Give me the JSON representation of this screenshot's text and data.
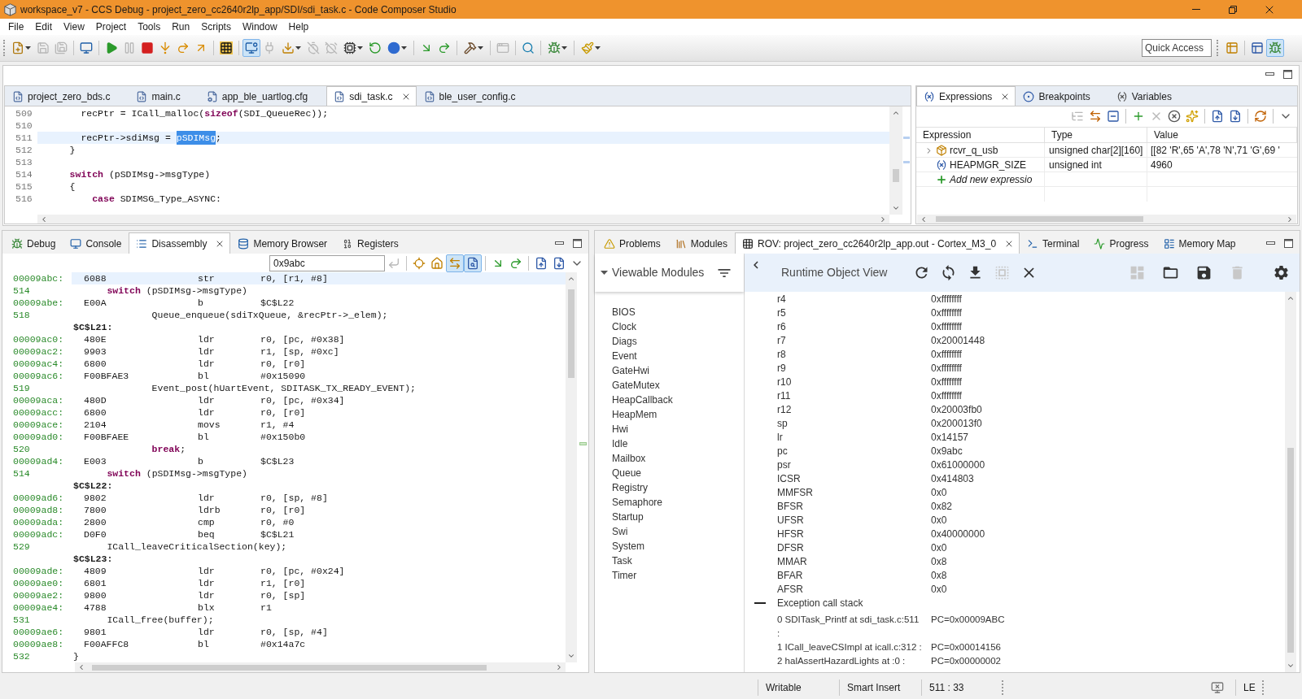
{
  "window": {
    "title": "workspace_v7 - CCS Debug - project_zero_cc2640r2lp_app/SDI/sdi_task.c - Code Composer Studio"
  },
  "menu": [
    "File",
    "Edit",
    "View",
    "Project",
    "Tools",
    "Run",
    "Scripts",
    "Window",
    "Help"
  ],
  "toolbar": {
    "buttons": [
      {
        "kind": "new",
        "disabled": false,
        "selected": false,
        "caret": true
      },
      {
        "kind": "save",
        "disabled": true,
        "selected": false
      },
      {
        "kind": "save_all",
        "disabled": true,
        "selected": false
      },
      {
        "kind": "separator"
      },
      {
        "kind": "monitor",
        "disabled": false,
        "selected": false
      },
      {
        "kind": "separator"
      },
      {
        "kind": "resume",
        "disabled": false,
        "selected": false
      },
      {
        "kind": "suspend",
        "disabled": true,
        "selected": false
      },
      {
        "kind": "terminate",
        "disabled": false,
        "selected": false
      },
      {
        "kind": "step_into",
        "disabled": false,
        "selected": false
      },
      {
        "kind": "step_over",
        "disabled": false,
        "selected": false
      },
      {
        "kind": "step_return",
        "disabled": false,
        "selected": false
      },
      {
        "kind": "separator"
      },
      {
        "kind": "grid",
        "disabled": false,
        "selected": false
      },
      {
        "kind": "separator"
      },
      {
        "kind": "target",
        "disabled": false,
        "selected": true
      },
      {
        "kind": "plug",
        "disabled": true,
        "selected": false
      },
      {
        "kind": "load",
        "disabled": false,
        "selected": false,
        "caret": true
      },
      {
        "kind": "timer_off",
        "disabled": true,
        "selected": false
      },
      {
        "kind": "clock_off",
        "disabled": true,
        "selected": false
      },
      {
        "kind": "chip",
        "disabled": false,
        "selected": false,
        "caret": true
      },
      {
        "kind": "restart",
        "disabled": false,
        "selected": false
      },
      {
        "kind": "ball",
        "disabled": false,
        "selected": false,
        "caret": true
      },
      {
        "kind": "separator"
      },
      {
        "kind": "asm_into",
        "disabled": false,
        "selected": false
      },
      {
        "kind": "asm_over",
        "disabled": false,
        "selected": false
      },
      {
        "kind": "separator"
      },
      {
        "kind": "hammer",
        "disabled": false,
        "selected": false,
        "caret": true
      },
      {
        "kind": "separator"
      },
      {
        "kind": "window",
        "disabled": true,
        "selected": false
      },
      {
        "kind": "separator"
      },
      {
        "kind": "search",
        "disabled": false,
        "selected": false
      },
      {
        "kind": "separator"
      },
      {
        "kind": "bug",
        "disabled": false,
        "selected": false,
        "caret": true
      },
      {
        "kind": "separator"
      },
      {
        "kind": "brush",
        "disabled": false,
        "selected": false,
        "caret": true
      }
    ],
    "quick_access": {
      "placeholder": "Quick Access"
    },
    "perspectives": [
      {
        "kind": "open_perspective",
        "disabled": false,
        "selected": false
      },
      {
        "kind": "separator"
      },
      {
        "kind": "edit_perspective",
        "disabled": false,
        "selected": false
      },
      {
        "kind": "debug_perspective",
        "disabled": false,
        "selected": true
      }
    ]
  },
  "editor": {
    "tabs": [
      {
        "label": "project_zero_bds.c",
        "kind": "c",
        "selected": false
      },
      {
        "label": "main.c",
        "kind": "c",
        "selected": false
      },
      {
        "label": "app_ble_uartlog.cfg",
        "kind": "cfg",
        "selected": false
      },
      {
        "label": "sdi_task.c",
        "kind": "c",
        "selected": true
      },
      {
        "label": "ble_user_config.c",
        "kind": "c",
        "selected": false
      }
    ],
    "lines": [
      {
        "number": "509",
        "current": false,
        "parts": [
          {
            "text": "      recPtr = ICall_malloc(**sizeof**(SDI_QueueRec));",
            "selected": false
          }
        ]
      },
      {
        "number": "510",
        "current": false
      },
      {
        "number": "511",
        "current": true,
        "parts": [
          {
            "text": "      recPtr->sdiMsg = ",
            "selected": false
          },
          {
            "text": "pSDIMsg",
            "selected": true
          },
          {
            "text": ";",
            "selected": false
          }
        ]
      },
      {
        "number": "512",
        "current": false,
        "parts": [
          {
            "text": "    }",
            "selected": false
          }
        ]
      },
      {
        "number": "513",
        "current": false
      },
      {
        "number": "514",
        "current": false,
        "parts": [
          {
            "text": "    **switch** (pSDIMsg->msgType)",
            "selected": false
          }
        ]
      },
      {
        "number": "515",
        "current": false,
        "parts": [
          {
            "text": "    {",
            "selected": false
          }
        ]
      },
      {
        "number": "516",
        "current": false,
        "parts": [
          {
            "text": "        **case** SDIMSG_Type_ASYNC:",
            "selected": false
          }
        ]
      }
    ]
  },
  "expressions": {
    "tabs": [
      {
        "label": "Expressions",
        "kind": "expressions",
        "selected": true
      },
      {
        "label": "Breakpoints",
        "kind": "breakpoints",
        "selected": false
      },
      {
        "label": "Variables",
        "kind": "variables",
        "selected": false
      }
    ],
    "toolbar": [
      {
        "kind": "tree",
        "disabled": true
      },
      {
        "kind": "arrows",
        "disabled": false
      },
      {
        "kind": "collapse",
        "disabled": false
      },
      {
        "kind": "separator"
      },
      {
        "kind": "add",
        "disabled": false
      },
      {
        "kind": "remove",
        "disabled": true
      },
      {
        "kind": "remove_all",
        "disabled": false
      },
      {
        "kind": "sparkle",
        "disabled": false
      },
      {
        "kind": "separator"
      },
      {
        "kind": "export",
        "disabled": false
      },
      {
        "kind": "import",
        "disabled": false
      },
      {
        "kind": "separator"
      },
      {
        "kind": "sync",
        "disabled": false
      },
      {
        "kind": "separator"
      },
      {
        "kind": "view_menu",
        "disabled": false
      }
    ],
    "columns": [
      "Expression",
      "Type",
      "Value"
    ],
    "rows": [
      {
        "kind": "array",
        "expanded": false,
        "expression": "rcvr_q_usb",
        "type": "unsigned char[2][160]",
        "value": "[[82 'R',65 'A',78 'N',71 'G',69 '"
      },
      {
        "kind": "variable",
        "expression": "HEAPMGR_SIZE",
        "type": "unsigned int",
        "value": "4960"
      }
    ],
    "add_row": "Add new expressio"
  },
  "disassembly_view": {
    "tabs": [
      {
        "label": "Debug",
        "kind": "debug",
        "selected": false
      },
      {
        "label": "Console",
        "kind": "console",
        "selected": false
      },
      {
        "label": "Disassembly",
        "kind": "disassembly",
        "selected": true
      },
      {
        "label": "Memory Browser",
        "kind": "memory",
        "selected": false
      },
      {
        "label": "Registers",
        "kind": "registers",
        "selected": false
      }
    ],
    "address": "0x9abc",
    "toolbar": [
      {
        "kind": "go",
        "disabled": true,
        "selected": false
      },
      {
        "kind": "separator"
      },
      {
        "kind": "show_pc",
        "disabled": false,
        "selected": false
      },
      {
        "kind": "home",
        "disabled": false,
        "selected": false
      },
      {
        "kind": "link_editor",
        "disabled": false,
        "selected": true
      },
      {
        "kind": "sync_source",
        "disabled": false,
        "selected": true
      },
      {
        "kind": "separator"
      },
      {
        "kind": "asm_into",
        "disabled": false,
        "selected": false
      },
      {
        "kind": "asm_over",
        "disabled": false,
        "selected": false
      },
      {
        "kind": "separator"
      },
      {
        "kind": "export",
        "disabled": false,
        "selected": false
      },
      {
        "kind": "import",
        "disabled": false,
        "selected": false
      },
      {
        "kind": "view_menu",
        "disabled": false,
        "selected": false
      }
    ],
    "lines": [
      {
        "kind": "instruction",
        "current": true,
        "address": "00009abc:",
        "opcode": "6088",
        "mnemonic": "str",
        "operands": "r0, [r1, #8]"
      },
      {
        "kind": "source",
        "current": false,
        "line": "514",
        "code": "      **switch** (pSDIMsg->msgType)"
      },
      {
        "kind": "instruction",
        "current": false,
        "address": "00009abe:",
        "opcode": "E00A",
        "mnemonic": "b",
        "operands": "$C$L22"
      },
      {
        "kind": "source",
        "current": false,
        "line": "518",
        "code": "              Queue_enqueue(sdiTxQueue, &recPtr->_elem);"
      },
      {
        "kind": "label",
        "current": false,
        "label": "$C$L21:"
      },
      {
        "kind": "instruction",
        "current": false,
        "address": "00009ac0:",
        "opcode": "480E",
        "mnemonic": "ldr",
        "operands": "r0, [pc, #0x38]"
      },
      {
        "kind": "instruction",
        "current": false,
        "address": "00009ac2:",
        "opcode": "9903",
        "mnemonic": "ldr",
        "operands": "r1, [sp, #0xc]"
      },
      {
        "kind": "instruction",
        "current": false,
        "address": "00009ac4:",
        "opcode": "6800",
        "mnemonic": "ldr",
        "operands": "r0, [r0]"
      },
      {
        "kind": "instruction",
        "current": false,
        "address": "00009ac6:",
        "opcode": "F00BFAE3",
        "mnemonic": "bl",
        "operands": "#0x15090"
      },
      {
        "kind": "source",
        "current": false,
        "line": "519",
        "code": "              Event_post(hUartEvent, SDITASK_TX_READY_EVENT);"
      },
      {
        "kind": "instruction",
        "current": false,
        "address": "00009aca:",
        "opcode": "480D",
        "mnemonic": "ldr",
        "operands": "r0, [pc, #0x34]"
      },
      {
        "kind": "instruction",
        "current": false,
        "address": "00009acc:",
        "opcode": "6800",
        "mnemonic": "ldr",
        "operands": "r0, [r0]"
      },
      {
        "kind": "instruction",
        "current": false,
        "address": "00009ace:",
        "opcode": "2104",
        "mnemonic": "movs",
        "operands": "r1, #4"
      },
      {
        "kind": "instruction",
        "current": false,
        "address": "00009ad0:",
        "opcode": "F00BFAEE",
        "mnemonic": "bl",
        "operands": "#0x150b0"
      },
      {
        "kind": "source",
        "current": false,
        "line": "520",
        "code": "              **break**;"
      },
      {
        "kind": "instruction",
        "current": false,
        "address": "00009ad4:",
        "opcode": "E003",
        "mnemonic": "b",
        "operands": "$C$L23"
      },
      {
        "kind": "source",
        "current": false,
        "line": "514",
        "code": "      **switch** (pSDIMsg->msgType)"
      },
      {
        "kind": "label",
        "current": false,
        "label": "$C$L22:"
      },
      {
        "kind": "instruction",
        "current": false,
        "address": "00009ad6:",
        "opcode": "9802",
        "mnemonic": "ldr",
        "operands": "r0, [sp, #8]"
      },
      {
        "kind": "instruction",
        "current": false,
        "address": "00009ad8:",
        "opcode": "7800",
        "mnemonic": "ldrb",
        "operands": "r0, [r0]"
      },
      {
        "kind": "instruction",
        "current": false,
        "address": "00009ada:",
        "opcode": "2800",
        "mnemonic": "cmp",
        "operands": "r0, #0"
      },
      {
        "kind": "instruction",
        "current": false,
        "address": "00009adc:",
        "opcode": "D0F0",
        "mnemonic": "beq",
        "operands": "$C$L21"
      },
      {
        "kind": "source",
        "current": false,
        "line": "529",
        "code": "      ICall_leaveCriticalSection(key);"
      },
      {
        "kind": "label",
        "current": false,
        "label": "$C$L23:"
      },
      {
        "kind": "instruction",
        "current": false,
        "address": "00009ade:",
        "opcode": "4809",
        "mnemonic": "ldr",
        "operands": "r0, [pc, #0x24]"
      },
      {
        "kind": "instruction",
        "current": false,
        "address": "00009ae0:",
        "opcode": "6801",
        "mnemonic": "ldr",
        "operands": "r1, [r0]"
      },
      {
        "kind": "instruction",
        "current": false,
        "address": "00009ae2:",
        "opcode": "9800",
        "mnemonic": "ldr",
        "operands": "r0, [sp]"
      },
      {
        "kind": "instruction",
        "current": false,
        "address": "00009ae4:",
        "opcode": "4788",
        "mnemonic": "blx",
        "operands": "r1"
      },
      {
        "kind": "source",
        "current": false,
        "line": "531",
        "code": "      ICall_free(buffer);"
      },
      {
        "kind": "instruction",
        "current": false,
        "address": "00009ae6:",
        "opcode": "9801",
        "mnemonic": "ldr",
        "operands": "r0, [sp, #4]"
      },
      {
        "kind": "instruction",
        "current": false,
        "address": "00009ae8:",
        "opcode": "F00AFFC8",
        "mnemonic": "bl",
        "operands": "#0x14a7c"
      },
      {
        "kind": "source",
        "current": false,
        "line": "532",
        "code": "}"
      }
    ]
  },
  "rov_view": {
    "tabs": [
      {
        "label": "Problems",
        "kind": "problems",
        "selected": false
      },
      {
        "label": "Modules",
        "kind": "modules",
        "selected": false
      },
      {
        "label": "ROV: project_zero_cc2640r2lp_app.out - Cortex_M3_0",
        "kind": "rov",
        "selected": true
      },
      {
        "label": "Terminal",
        "kind": "terminal",
        "selected": false
      },
      {
        "label": "Progress",
        "kind": "progress",
        "selected": false
      },
      {
        "label": "Memory Map",
        "kind": "memory_map",
        "selected": false
      }
    ],
    "modules": {
      "title": "Viewable Modules",
      "expanded": true,
      "items": [
        "BIOS",
        "Clock",
        "Diags",
        "Event",
        "GateHwi",
        "GateMutex",
        "HeapCallback",
        "HeapMem",
        "Hwi",
        "Idle",
        "Mailbox",
        "Queue",
        "Registry",
        "Semaphore",
        "Startup",
        "Swi",
        "System",
        "Task",
        "Timer"
      ]
    },
    "title": "Runtime Object View",
    "tools": [
      [
        {
          "kind": "refresh",
          "disabled": false
        },
        {
          "kind": "sync",
          "disabled": false
        },
        {
          "kind": "download",
          "disabled": false
        },
        {
          "kind": "select",
          "disabled": true
        },
        {
          "kind": "close",
          "disabled": false
        }
      ],
      [
        {
          "kind": "dashboard",
          "disabled": true
        },
        {
          "kind": "folder",
          "disabled": false
        },
        {
          "kind": "save",
          "disabled": false
        },
        {
          "kind": "trash",
          "disabled": true
        }
      ],
      [
        {
          "kind": "settings",
          "disabled": false
        }
      ]
    ],
    "registers": [
      {
        "name": "r4",
        "value": "0xffffffff"
      },
      {
        "name": "r5",
        "value": "0xffffffff"
      },
      {
        "name": "r6",
        "value": "0xffffffff"
      },
      {
        "name": "r7",
        "value": "0x20001448"
      },
      {
        "name": "r8",
        "value": "0xffffffff"
      },
      {
        "name": "r9",
        "value": "0xffffffff"
      },
      {
        "name": "r10",
        "value": "0xffffffff"
      },
      {
        "name": "r11",
        "value": "0xffffffff"
      },
      {
        "name": "r12",
        "value": "0x20003fb0"
      },
      {
        "name": "sp",
        "value": "0x200013f0"
      },
      {
        "name": "lr",
        "value": "0x14157"
      },
      {
        "name": "pc",
        "value": "0x9abc"
      },
      {
        "name": "psr",
        "value": "0x61000000"
      },
      {
        "name": "ICSR",
        "value": "0x414803"
      },
      {
        "name": "MMFSR",
        "value": "0x0"
      },
      {
        "name": "BFSR",
        "value": "0x82"
      },
      {
        "name": "UFSR",
        "value": "0x0"
      },
      {
        "name": "HFSR",
        "value": "0x40000000"
      },
      {
        "name": "DFSR",
        "value": "0x0"
      },
      {
        "name": "MMAR",
        "value": "0x8"
      },
      {
        "name": "BFAR",
        "value": "0x8"
      },
      {
        "name": "AFSR",
        "value": "0x0"
      }
    ],
    "call_stack": {
      "title": "Exception call stack",
      "expanded": true,
      "frames": [
        {
          "frame": "0 SDITask_Printf at sdi_task.c:511\n:",
          "pc": "PC=0x00009ABC"
        },
        {
          "frame": "1 ICall_leaveCSImpl at icall.c:312 :",
          "pc": "PC=0x00014156"
        },
        {
          "frame": "2 halAssertHazardLights at :0 :",
          "pc": "PC=0x00000002"
        }
      ]
    }
  },
  "status_bar": {
    "fields": [
      "Writable",
      "Smart Insert",
      "511 : 33",
      "LE"
    ]
  }
}
